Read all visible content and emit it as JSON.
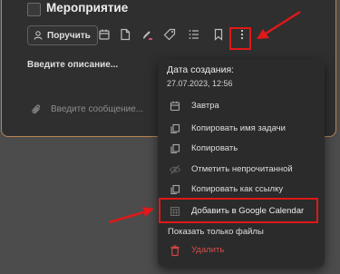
{
  "task": {
    "title": "Мероприятие",
    "assign_label": "Поручить",
    "description_placeholder": "Введите описание...",
    "message_placeholder": "Введите сообщение..."
  },
  "toolbar_icons": [
    "user-icon",
    "calendar-icon",
    "file-icon",
    "pen-icon",
    "tag-icon",
    "list-icon",
    "bookmark-icon",
    "more-vertical-icon"
  ],
  "menu": {
    "created_label": "Дата создания:",
    "created_value": "27.07.2023, 12:56",
    "items": [
      {
        "label": "Завтра",
        "icon": "calendar-icon"
      },
      {
        "label": "Копировать имя задачи",
        "icon": "copy-icon"
      },
      {
        "label": "Копировать",
        "icon": "copy-icon"
      },
      {
        "label": "Отметить непрочитанной",
        "icon": "eye-off-icon"
      },
      {
        "label": "Копировать как ссылку",
        "icon": "copy-icon"
      },
      {
        "label": "Добавить в Google Calendar",
        "icon": "calendar-grid-icon"
      },
      {
        "label": "Показать только файлы",
        "icon": ""
      },
      {
        "label": "Удалить",
        "icon": "trash-icon"
      }
    ]
  },
  "colors": {
    "card_border": "#b98552",
    "highlight": "#e01818",
    "danger_text": "#dd4a4a"
  }
}
